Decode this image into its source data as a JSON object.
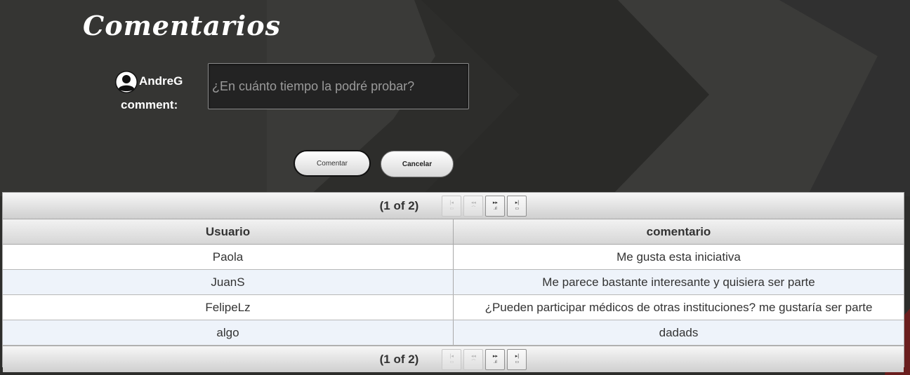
{
  "page": {
    "title": "Comentarios",
    "colors": {
      "background": "#2f2f2d",
      "text": "#ffffff",
      "table_alt_row": "#eef3fa"
    }
  },
  "comment_form": {
    "avatar_icon": "user-circle-icon",
    "username": "AndreG",
    "comment_label": "comment:",
    "input_placeholder": "¿En cuánto tiempo la podré probar?",
    "input_value": "",
    "submit_label": "Comentar",
    "cancel_label": "Cancelar"
  },
  "table": {
    "page_report": "(1 of 2)",
    "paginator_icons": [
      "first-page-icon",
      "prev-page-icon",
      "next-page-icon",
      "last-page-icon"
    ],
    "columns": [
      "Usuario",
      "comentario"
    ],
    "rows": [
      {
        "usuario": "Paola",
        "comentario": "Me gusta esta iniciativa"
      },
      {
        "usuario": "JuanS",
        "comentario": "Me parece bastante interesante y quisiera ser parte"
      },
      {
        "usuario": "FelipeLz",
        "comentario": "¿Pueden participar médicos de otras instituciones? me gustaría ser parte"
      },
      {
        "usuario": "algo",
        "comentario": "dadads"
      }
    ]
  }
}
